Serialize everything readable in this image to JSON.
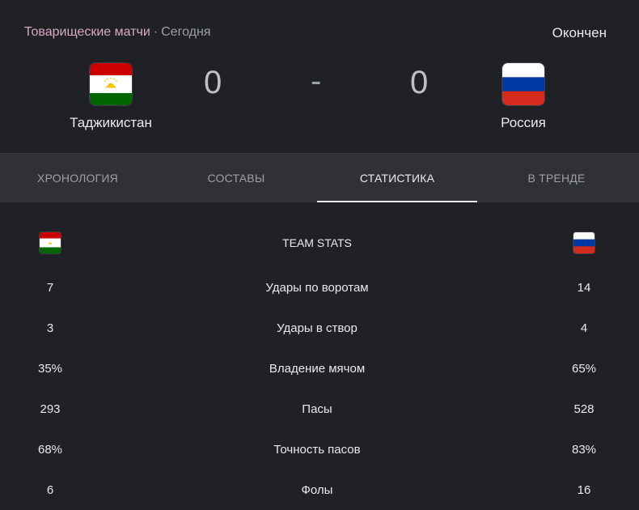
{
  "match": {
    "league": "Товарищеские матчи",
    "separator": "·",
    "day": "Сегодня",
    "status": "Окончен",
    "home": {
      "name": "Таджикистан",
      "score": "0",
      "flag": "flag-tajikistan"
    },
    "away": {
      "name": "Россия",
      "score": "0",
      "flag": "flag-russia"
    },
    "dash": "-"
  },
  "tabs": [
    {
      "label": "Хронология",
      "active": false
    },
    {
      "label": "Составы",
      "active": false
    },
    {
      "label": "Статистика",
      "active": true
    },
    {
      "label": "В тренде",
      "active": false
    }
  ],
  "stats": {
    "title": "TEAM STATS",
    "rows": [
      {
        "home": "7",
        "label": "Удары по воротам",
        "away": "14"
      },
      {
        "home": "3",
        "label": "Удары в створ",
        "away": "4"
      },
      {
        "home": "35%",
        "label": "Владение мячом",
        "away": "65%"
      },
      {
        "home": "293",
        "label": "Пасы",
        "away": "528"
      },
      {
        "home": "68%",
        "label": "Точность пасов",
        "away": "83%"
      },
      {
        "home": "6",
        "label": "Фолы",
        "away": "16"
      }
    ]
  },
  "colors": {
    "tajik_red": "#cc0000",
    "tajik_white": "#ffffff",
    "tajik_green": "#006600",
    "tajik_emblem": "#f8c300",
    "russia_white": "#ffffff",
    "russia_blue": "#0039a6",
    "russia_red": "#d52b1e"
  }
}
